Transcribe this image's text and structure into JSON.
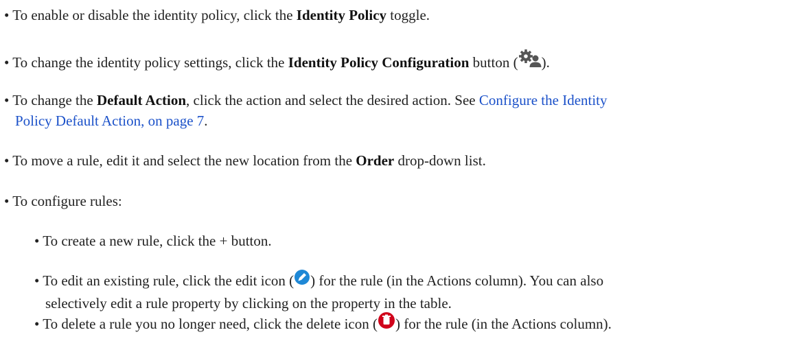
{
  "bullets": {
    "toggle": {
      "pre": "To enable or disable the identity policy, click the ",
      "bold": "Identity Policy",
      "post": " toggle."
    },
    "config": {
      "pre": "To change the identity policy settings, click the ",
      "bold": "Identity Policy Configuration",
      "mid": " button (",
      "icon": "gears-user-icon",
      "post": ")."
    },
    "default_action": {
      "pre": "To change the ",
      "bold": "Default Action",
      "mid": ", click the action and select the desired action. See ",
      "link_line1": "Configure the Identity",
      "link_line2": "Policy Default Action, on page 7",
      "post": "."
    },
    "move": {
      "pre": "To move a rule, edit it and select the new location from the ",
      "bold": "Order",
      "post": " drop-down list."
    },
    "configure": {
      "text": "To configure rules:"
    }
  },
  "sub_bullets": {
    "create": {
      "text": "To create a new rule, click the + button."
    },
    "edit": {
      "pre": "To edit an existing rule, click the edit icon (",
      "icon": "edit-icon",
      "mid": ") for the rule (in the Actions column). You can also",
      "line2": "selectively edit a rule property by clicking on the property in the table."
    },
    "delete": {
      "pre": "To delete a rule you no longer need, click the delete icon (",
      "icon": "delete-icon",
      "post": ") for the rule (in the Actions column)."
    }
  },
  "bullet_char": "•",
  "colors": {
    "link": "#1b51c9",
    "edit_icon": "#1e88d6",
    "delete_icon": "#d0021b",
    "gear_icon": "#555555"
  }
}
